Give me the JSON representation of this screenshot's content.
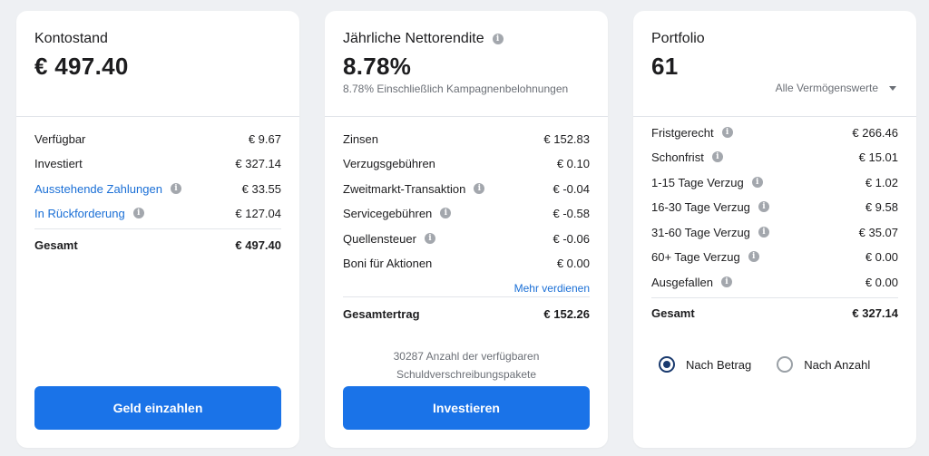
{
  "balance_card": {
    "title": "Kontostand",
    "value": "€ 497.40",
    "rows": [
      {
        "label": "Verfügbar",
        "value": "€ 9.67"
      },
      {
        "label": "Investiert",
        "value": "€ 327.14"
      },
      {
        "label": "Ausstehende Zahlungen",
        "value": "€ 33.55"
      },
      {
        "label": "In Rückforderung",
        "value": "€ 127.04"
      }
    ],
    "total": {
      "label": "Gesamt",
      "value": "€ 497.40"
    },
    "button": "Geld einzahlen"
  },
  "return_card": {
    "title": "Jährliche Nettorendite",
    "value": "8.78%",
    "subtitle": "8.78% Einschließlich Kampagnenbelohnungen",
    "rows": [
      {
        "label": "Zinsen",
        "value": "€ 152.83"
      },
      {
        "label": "Verzugsgebühren",
        "value": "€ 0.10"
      },
      {
        "label": "Zweitmarkt-Transaktion",
        "value": "€ -0.04"
      },
      {
        "label": "Servicegebühren",
        "value": "€ -0.58"
      },
      {
        "label": "Quellensteuer",
        "value": "€ -0.06"
      },
      {
        "label": "Boni für Aktionen",
        "value": "€ 0.00"
      }
    ],
    "more_link": "Mehr verdienen",
    "total": {
      "label": "Gesamtertrag",
      "value": "€ 152.26"
    },
    "packages_line1": "30287 Anzahl der verfügbaren",
    "packages_line2": "Schuldverschreibungspakete",
    "button": "Investieren"
  },
  "portfolio_card": {
    "title": "Portfolio",
    "value": "61",
    "dropdown": "Alle Vermögenswerte",
    "rows": [
      {
        "label": "Fristgerecht",
        "value": "€ 266.46"
      },
      {
        "label": "Schonfrist",
        "value": "€ 15.01"
      },
      {
        "label": "1-15 Tage Verzug",
        "value": "€ 1.02"
      },
      {
        "label": "16-30 Tage Verzug",
        "value": "€ 9.58"
      },
      {
        "label": "31-60 Tage Verzug",
        "value": "€ 35.07"
      },
      {
        "label": "60+ Tage Verzug",
        "value": "€ 0.00"
      },
      {
        "label": "Ausgefallen",
        "value": "€ 0.00"
      }
    ],
    "total": {
      "label": "Gesamt",
      "value": "€ 327.14"
    },
    "radio_amount": "Nach Betrag",
    "radio_count": "Nach Anzahl",
    "selected_radio": "Nach Betrag"
  },
  "info_icon_glyph": "i",
  "colors": {
    "accent": "#1a73e8",
    "link": "#1a6fd6",
    "radio_selected": "#1a3a6e"
  }
}
